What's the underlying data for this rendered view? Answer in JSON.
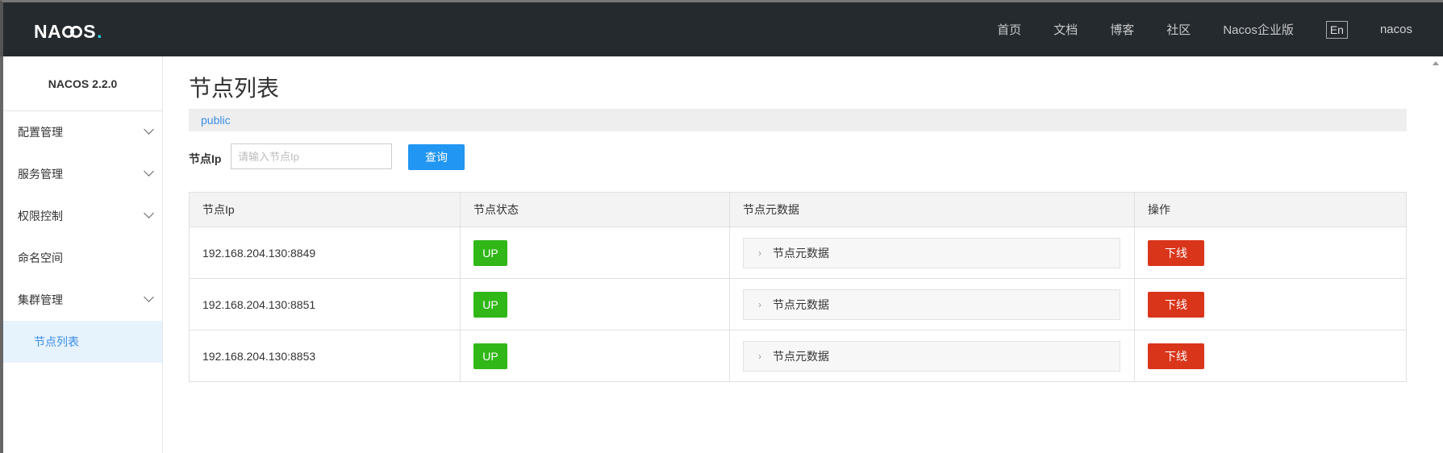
{
  "header": {
    "logo_text": "NACOS",
    "nav": [
      "首页",
      "文档",
      "博客",
      "社区",
      "Nacos企业版"
    ],
    "lang": "En",
    "user": "nacos"
  },
  "sidebar": {
    "version": "NACOS 2.2.0",
    "items": [
      {
        "label": "配置管理",
        "expandable": true
      },
      {
        "label": "服务管理",
        "expandable": true
      },
      {
        "label": "权限控制",
        "expandable": true
      },
      {
        "label": "命名空间",
        "expandable": false
      },
      {
        "label": "集群管理",
        "expandable": true
      }
    ],
    "active_sub": "节点列表"
  },
  "main": {
    "title": "节点列表",
    "namespace": "public",
    "search": {
      "label": "节点Ip",
      "placeholder": "请输入节点Ip",
      "value": "",
      "button": "查询"
    },
    "table": {
      "headers": [
        "节点Ip",
        "节点状态",
        "节点元数据",
        "操作"
      ],
      "rows": [
        {
          "ip": "192.168.204.130:8849",
          "status": "UP",
          "meta": "节点元数据",
          "action": "下线"
        },
        {
          "ip": "192.168.204.130:8851",
          "status": "UP",
          "meta": "节点元数据",
          "action": "下线"
        },
        {
          "ip": "192.168.204.130:8853",
          "status": "UP",
          "meta": "节点元数据",
          "action": "下线"
        }
      ]
    }
  },
  "colors": {
    "header_bg": "#252a2f",
    "primary": "#2196f3",
    "status_up": "#31b718",
    "danger": "#d9351b",
    "active_bg": "#e6f2fc"
  },
  "icons": {
    "menu_expand": "chevron-down-icon",
    "meta_expand": "chevron-right-icon"
  }
}
